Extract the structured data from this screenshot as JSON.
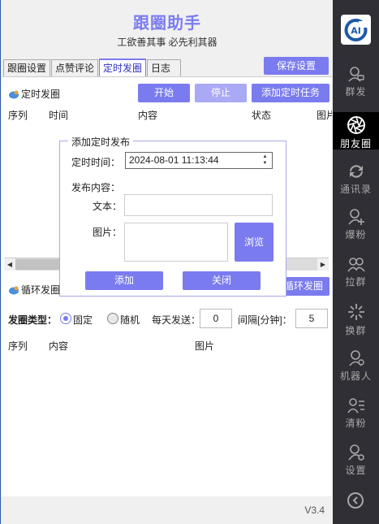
{
  "header": {
    "title": "跟圈助手",
    "slogan": "工欲善其事 必先利其器"
  },
  "tabs": [
    {
      "label": "跟圈设置"
    },
    {
      "label": "点赞评论"
    },
    {
      "label": "定时发圈"
    },
    {
      "label": "日志"
    }
  ],
  "save_label": "保存设置",
  "scheduled": {
    "section_label": "定时发圈",
    "start_label": "开始",
    "stop_label": "停止",
    "add_task_label": "添加定时任务",
    "columns": [
      "序列",
      "时间",
      "内容",
      "状态",
      "图片"
    ]
  },
  "loop": {
    "section_label": "循环发圈",
    "button_label": "循环发圈",
    "type_label": "发圈类型：",
    "fixed_label": "固定",
    "random_label": "随机",
    "daily_label": "每天发送：",
    "daily_value": "0",
    "interval_label": "间隔[分钟]：",
    "interval_value": "5",
    "columns": [
      "序列",
      "内容",
      "图片"
    ]
  },
  "dialog": {
    "title": "添加定时发布",
    "time_label": "定时时间：",
    "time_value": "2024-08-01 11:13:44",
    "content_label": "发布内容：",
    "text_label": "文本：",
    "image_label": "图片：",
    "browse_label": "浏览",
    "add_label": "添加",
    "close_label": "关闭"
  },
  "sidebar": {
    "logo_text": "AI",
    "items": [
      {
        "label": "群发",
        "icon": "person-chat-icon"
      },
      {
        "label": "朋友圈",
        "icon": "aperture-icon"
      },
      {
        "label": "通讯录",
        "icon": "sync-icon"
      },
      {
        "label": "爆粉",
        "icon": "add-user-icon"
      },
      {
        "label": "拉群",
        "icon": "group-icon"
      },
      {
        "label": "换群",
        "icon": "sparkle-icon"
      },
      {
        "label": "机器人",
        "icon": "robot-user-icon"
      },
      {
        "label": "清粉",
        "icon": "user-list-icon"
      },
      {
        "label": "设置",
        "icon": "user-settings-icon"
      }
    ]
  },
  "version": "V3.4",
  "colors": {
    "accent": "#7b7bf0",
    "sidebar_bg": "#2f2f35",
    "sidebar_active": "#000000"
  }
}
